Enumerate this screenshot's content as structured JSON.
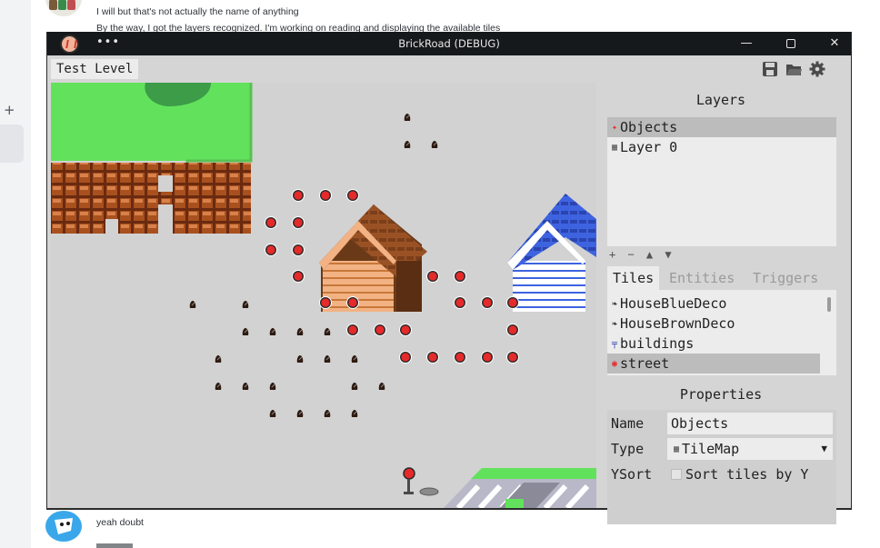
{
  "chat": {
    "message_1": "I will but that's not actually the name of anything",
    "message_2": "By the way, I got the layers recognized. I'm working on reading and displaying the available tiles",
    "message_3": "yeah doubt",
    "plus": "+"
  },
  "window": {
    "title": "BrickRoad (DEBUG)",
    "menu": "•••",
    "minimize": "—",
    "close": "✕"
  },
  "toolbar": {
    "level_name": "Test Level"
  },
  "layers": {
    "heading": "Layers",
    "items": [
      {
        "label": "Objects",
        "selected": true
      },
      {
        "label": "Layer 0",
        "selected": false
      }
    ],
    "tools": "+ − ▲ ▼"
  },
  "tabs": {
    "items": [
      "Tiles",
      "Entities",
      "Triggers"
    ],
    "active": "Tiles"
  },
  "tiles": {
    "items": [
      {
        "label": "HouseBlueDeco",
        "icon": "bush-icon"
      },
      {
        "label": "HouseBrownDeco",
        "icon": "bush-icon"
      },
      {
        "label": "buildings",
        "icon": "building-tile-icon"
      },
      {
        "label": "street",
        "icon": "red-marker-icon",
        "selected": true
      }
    ]
  },
  "properties": {
    "heading": "Properties",
    "name_label": "Name",
    "name_value": "Objects",
    "type_label": "Type",
    "type_value": "TileMap",
    "ysort_label": "YSort",
    "ysort_text": "Sort tiles by Y",
    "ysort_checked": false
  },
  "colors": {
    "titlebar": "#16191b",
    "selected_row": "#bcbcbc",
    "grass": "#62e25c",
    "marker": "#e42a2a",
    "house_brown": "#c8773a",
    "house_blue": "#3e63e0"
  }
}
